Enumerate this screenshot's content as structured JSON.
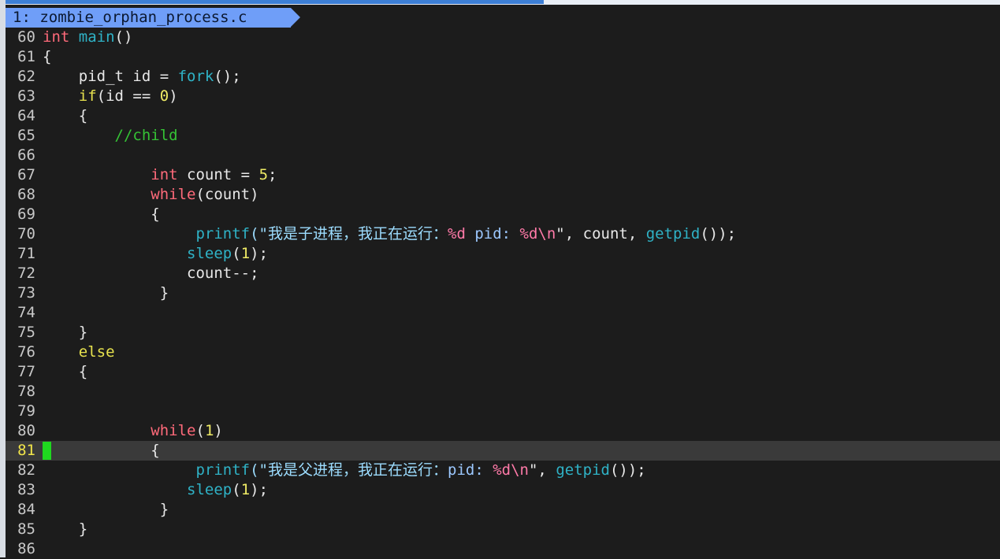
{
  "tab": {
    "label": "1: zombie_orphan_process.c"
  },
  "cursor_line": "81",
  "colors": {
    "keyword": "#ff6a7a",
    "conditional": "#e7e24e",
    "function": "#2fb2c6",
    "number": "#f0ec66",
    "comment": "#35c235",
    "cursor": "#1fd81f"
  },
  "lines": [
    {
      "n": "60",
      "tokens": [
        {
          "t": "int",
          "c": "kw"
        },
        {
          "t": " "
        },
        {
          "t": "main",
          "c": "fn"
        },
        {
          "t": "()"
        }
      ]
    },
    {
      "n": "61",
      "tokens": [
        {
          "t": "{"
        }
      ]
    },
    {
      "n": "62",
      "tokens": [
        {
          "t": "    pid_t id = "
        },
        {
          "t": "fork",
          "c": "fn"
        },
        {
          "t": "();"
        }
      ]
    },
    {
      "n": "63",
      "tokens": [
        {
          "t": "    "
        },
        {
          "t": "if",
          "c": "kw2"
        },
        {
          "t": "(id == "
        },
        {
          "t": "0",
          "c": "num"
        },
        {
          "t": ")"
        }
      ]
    },
    {
      "n": "64",
      "tokens": [
        {
          "t": "    {"
        }
      ]
    },
    {
      "n": "65",
      "tokens": [
        {
          "t": "        "
        },
        {
          "t": "//child",
          "c": "cmt"
        }
      ]
    },
    {
      "n": "66",
      "tokens": []
    },
    {
      "n": "67",
      "tokens": [
        {
          "t": "            "
        },
        {
          "t": "int",
          "c": "kw"
        },
        {
          "t": " count = "
        },
        {
          "t": "5",
          "c": "num"
        },
        {
          "t": ";"
        }
      ]
    },
    {
      "n": "68",
      "tokens": [
        {
          "t": "            "
        },
        {
          "t": "while",
          "c": "kw"
        },
        {
          "t": "(count)"
        }
      ]
    },
    {
      "n": "69",
      "tokens": [
        {
          "t": "            {"
        }
      ]
    },
    {
      "n": "70",
      "tokens": [
        {
          "t": "                 "
        },
        {
          "t": "printf",
          "c": "fn"
        },
        {
          "t": "(\"我是子进程，我正在运行：",
          "c": "str"
        },
        {
          "t": "%d",
          "c": "fmt"
        },
        {
          "t": " pid: ",
          "c": "fmtword"
        },
        {
          "t": "%d\\n",
          "c": "fmt"
        },
        {
          "t": "\""
        },
        {
          "t": ", count, "
        },
        {
          "t": "getpid",
          "c": "fn"
        },
        {
          "t": "());"
        }
      ]
    },
    {
      "n": "71",
      "tokens": [
        {
          "t": "                "
        },
        {
          "t": "sleep",
          "c": "fn"
        },
        {
          "t": "("
        },
        {
          "t": "1",
          "c": "num"
        },
        {
          "t": ");"
        }
      ]
    },
    {
      "n": "72",
      "tokens": [
        {
          "t": "                count--;"
        }
      ]
    },
    {
      "n": "73",
      "tokens": [
        {
          "t": "             }"
        }
      ]
    },
    {
      "n": "74",
      "tokens": []
    },
    {
      "n": "75",
      "tokens": [
        {
          "t": "    }"
        }
      ]
    },
    {
      "n": "76",
      "tokens": [
        {
          "t": "    "
        },
        {
          "t": "else",
          "c": "kw2"
        }
      ]
    },
    {
      "n": "77",
      "tokens": [
        {
          "t": "    {"
        }
      ]
    },
    {
      "n": "78",
      "tokens": []
    },
    {
      "n": "79",
      "tokens": []
    },
    {
      "n": "80",
      "tokens": [
        {
          "t": "            "
        },
        {
          "t": "while",
          "c": "kw"
        },
        {
          "t": "("
        },
        {
          "t": "1",
          "c": "num"
        },
        {
          "t": ")"
        }
      ]
    },
    {
      "n": "81",
      "tokens": [
        {
          "t": "            {"
        }
      ]
    },
    {
      "n": "82",
      "tokens": [
        {
          "t": "                 "
        },
        {
          "t": "printf",
          "c": "fn"
        },
        {
          "t": "(\"我是父进程，我正在运行：",
          "c": "str"
        },
        {
          "t": "pid: ",
          "c": "fmtword"
        },
        {
          "t": "%d\\n",
          "c": "fmt"
        },
        {
          "t": "\""
        },
        {
          "t": ", "
        },
        {
          "t": "getpid",
          "c": "fn"
        },
        {
          "t": "());"
        }
      ]
    },
    {
      "n": "83",
      "tokens": [
        {
          "t": "                "
        },
        {
          "t": "sleep",
          "c": "fn"
        },
        {
          "t": "("
        },
        {
          "t": "1",
          "c": "num"
        },
        {
          "t": ");"
        }
      ]
    },
    {
      "n": "84",
      "tokens": [
        {
          "t": "             }"
        }
      ]
    },
    {
      "n": "85",
      "tokens": [
        {
          "t": "    }"
        }
      ]
    },
    {
      "n": "86",
      "tokens": []
    }
  ]
}
